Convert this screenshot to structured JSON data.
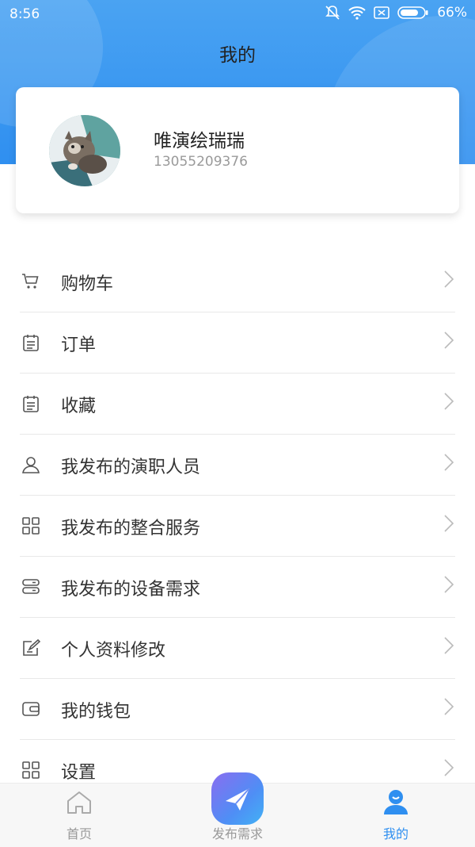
{
  "status_bar": {
    "time": "8:56",
    "battery": "66%"
  },
  "header": {
    "title": "我的"
  },
  "profile": {
    "name": "唯演绘瑞瑞",
    "phone": "13055209376"
  },
  "menu": [
    {
      "label": "购物车",
      "icon": "cart-icon"
    },
    {
      "label": "订单",
      "icon": "clipboard-icon"
    },
    {
      "label": "收藏",
      "icon": "clipboard-icon"
    },
    {
      "label": "我发布的演职人员",
      "icon": "person-icon"
    },
    {
      "label": "我发布的整合服务",
      "icon": "grid-icon"
    },
    {
      "label": "我发布的设备需求",
      "icon": "server-icon"
    },
    {
      "label": "个人资料修改",
      "icon": "edit-icon"
    },
    {
      "label": "我的钱包",
      "icon": "wallet-icon"
    },
    {
      "label": "设置",
      "icon": "grid-icon"
    }
  ],
  "tabs": {
    "home": "首页",
    "publish": "发布需求",
    "mine": "我的"
  },
  "colors": {
    "accent": "#2f8ff0",
    "header": "#3d9af2",
    "text": "#333333",
    "muted": "#9a9a9a"
  }
}
